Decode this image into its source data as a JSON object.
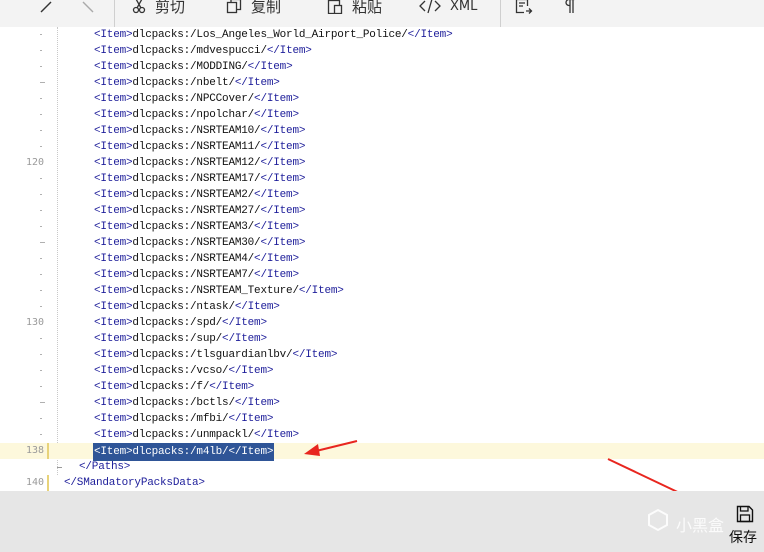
{
  "toolbar": {
    "cut_label": "剪切",
    "copy_label": "复制",
    "paste_label": "粘贴",
    "xml_label": "XML"
  },
  "editor": {
    "lines": [
      {
        "num": "",
        "content": "dlcpacks:/Los_Angeles_World_Airport_Police/"
      },
      {
        "num": "",
        "content": "dlcpacks:/mdvespucci/"
      },
      {
        "num": "",
        "content": "dlcpacks:/MODDING/"
      },
      {
        "num": "",
        "content": "dlcpacks:/nbelt/"
      },
      {
        "num": "",
        "content": "dlcpacks:/NPCCover/"
      },
      {
        "num": "",
        "content": "dlcpacks:/npolchar/"
      },
      {
        "num": "",
        "content": "dlcpacks:/NSRTEAM10/"
      },
      {
        "num": "",
        "content": "dlcpacks:/NSRTEAM11/"
      },
      {
        "num": "120",
        "content": "dlcpacks:/NSRTEAM12/"
      },
      {
        "num": "",
        "content": "dlcpacks:/NSRTEAM17/"
      },
      {
        "num": "",
        "content": "dlcpacks:/NSRTEAM2/"
      },
      {
        "num": "",
        "content": "dlcpacks:/NSRTEAM27/"
      },
      {
        "num": "",
        "content": "dlcpacks:/NSRTEAM3/"
      },
      {
        "num": "",
        "content": "dlcpacks:/NSRTEAM30/"
      },
      {
        "num": "",
        "content": "dlcpacks:/NSRTEAM4/"
      },
      {
        "num": "",
        "content": "dlcpacks:/NSRTEAM7/"
      },
      {
        "num": "",
        "content": "dlcpacks:/NSRTEAM_Texture/"
      },
      {
        "num": "",
        "content": "dlcpacks:/ntask/"
      },
      {
        "num": "130",
        "content": "dlcpacks:/spd/"
      },
      {
        "num": "",
        "content": "dlcpacks:/sup/"
      },
      {
        "num": "",
        "content": "dlcpacks:/tlsguardianlbv/"
      },
      {
        "num": "",
        "content": "dlcpacks:/vcso/"
      },
      {
        "num": "",
        "content": "dlcpacks:/f/"
      },
      {
        "num": "",
        "content": "dlcpacks:/bctls/"
      },
      {
        "num": "",
        "content": "dlcpacks:/mfbi/"
      },
      {
        "num": "",
        "content": "dlcpacks:/unmpackl/"
      },
      {
        "num": "138",
        "content": "dlcpacks:/m4lb/"
      }
    ],
    "item_open_tag": "<Item>",
    "item_close_tag": "</Item>",
    "paths_close": "</Paths>",
    "root_close": "</SMandatoryPacksData>",
    "line_139_num": "",
    "line_140_num": "140"
  },
  "bottom": {
    "save_label": "保存",
    "watermark": "小黑盒"
  },
  "colors": {
    "tag": "#1e1e9a",
    "selection": "#2f5597",
    "current_line": "#fdf8dc",
    "annotation_arrow": "#e8261f"
  }
}
